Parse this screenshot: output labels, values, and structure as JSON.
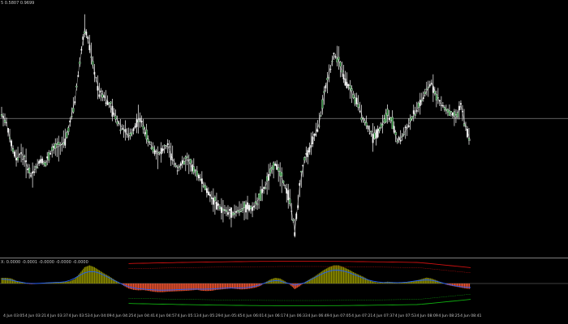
{
  "chart_window": {
    "price_header": "5 0.5807 0.9699",
    "indicator_header": "X: 0.0000 -0.0001 -0.0000 -0.0000 -0.0000"
  },
  "colors": {
    "background": "#000000",
    "candle": "#ffffff",
    "candle_up_body": "#2e8b3a",
    "current_price_line": "#7f7f7f",
    "histogram_positive": "#8b8b00",
    "histogram_negative": "#e8512f",
    "signal_line": "#1f5fff",
    "upper_band": "#d01010",
    "lower_band": "#10b010"
  },
  "chart_data": [
    {
      "type": "line",
      "name": "price",
      "x_ticks": [
        "4 Jun 03:05",
        "4 Jun 03:21",
        "4 Jun 03:37",
        "4 Jun 03:53",
        "4 Jun 04:09",
        "4 Jun 04:25",
        "4 Jun 04:41",
        "4 Jun 04:57",
        "4 Jun 05:13",
        "4 Jun 05:29",
        "4 Jun 05:45",
        "4 Jun 06:01",
        "4 Jun 06:17",
        "4 Jun 06:33",
        "4 Jun 06:49",
        "4 Jun 07:05",
        "4 Jun 07:21",
        "4 Jun 07:37",
        "4 Jun 07:53",
        "4 Jun 08:09",
        "4 Jun 08:25",
        "4 Jun 08:41"
      ],
      "close": [
        0.62,
        0.58,
        0.48,
        0.42,
        0.45,
        0.4,
        0.35,
        0.38,
        0.42,
        0.4,
        0.45,
        0.47,
        0.48,
        0.5,
        0.58,
        0.68,
        0.85,
        1.0,
        0.92,
        0.8,
        0.72,
        0.7,
        0.66,
        0.62,
        0.58,
        0.55,
        0.52,
        0.55,
        0.6,
        0.57,
        0.5,
        0.47,
        0.44,
        0.46,
        0.48,
        0.42,
        0.38,
        0.4,
        0.42,
        0.38,
        0.36,
        0.32,
        0.28,
        0.25,
        0.22,
        0.2,
        0.19,
        0.18,
        0.19,
        0.2,
        0.21,
        0.2,
        0.22,
        0.26,
        0.3,
        0.36,
        0.4,
        0.36,
        0.3,
        0.24,
        0.1,
        0.3,
        0.42,
        0.46,
        0.52,
        0.58,
        0.7,
        0.8,
        0.88,
        0.86,
        0.78,
        0.74,
        0.7,
        0.66,
        0.6,
        0.56,
        0.52,
        0.54,
        0.58,
        0.62,
        0.58,
        0.5,
        0.52,
        0.56,
        0.6,
        0.64,
        0.68,
        0.72,
        0.76,
        0.7,
        0.66,
        0.64,
        0.62,
        0.6,
        0.66,
        0.56,
        0.5
      ],
      "current_price_level": 0.6,
      "y_range": [
        0.05,
        1.08
      ]
    },
    {
      "type": "bar",
      "name": "oscillator",
      "values": [
        0.25,
        0.25,
        0.22,
        0.12,
        0.06,
        0.0,
        -0.03,
        -0.02,
        0.02,
        0.04,
        0.05,
        0.06,
        0.06,
        0.07,
        0.1,
        0.2,
        0.45,
        0.72,
        0.8,
        0.72,
        0.58,
        0.44,
        0.32,
        0.18,
        0.05,
        -0.1,
        -0.22,
        -0.28,
        -0.3,
        -0.29,
        -0.32,
        -0.36,
        -0.38,
        -0.38,
        -0.36,
        -0.35,
        -0.34,
        -0.33,
        -0.32,
        -0.3,
        -0.28,
        -0.32,
        -0.33,
        -0.32,
        -0.28,
        -0.26,
        -0.24,
        -0.22,
        -0.24,
        -0.26,
        -0.25,
        -0.22,
        -0.18,
        -0.1,
        0.05,
        0.18,
        0.25,
        0.22,
        0.1,
        -0.05,
        -0.25,
        -0.12,
        0.05,
        0.18,
        0.3,
        0.45,
        0.6,
        0.72,
        0.8,
        0.8,
        0.72,
        0.62,
        0.5,
        0.4,
        0.3,
        0.18,
        0.08,
        0.04,
        0.05,
        0.08,
        0.06,
        0.02,
        0.04,
        0.07,
        0.1,
        0.14,
        0.2,
        0.26,
        0.22,
        0.14,
        0.05,
        -0.05,
        -0.1,
        -0.14,
        -0.18,
        -0.22,
        -0.24
      ],
      "y_range": [
        -1.0,
        1.0
      ]
    }
  ]
}
